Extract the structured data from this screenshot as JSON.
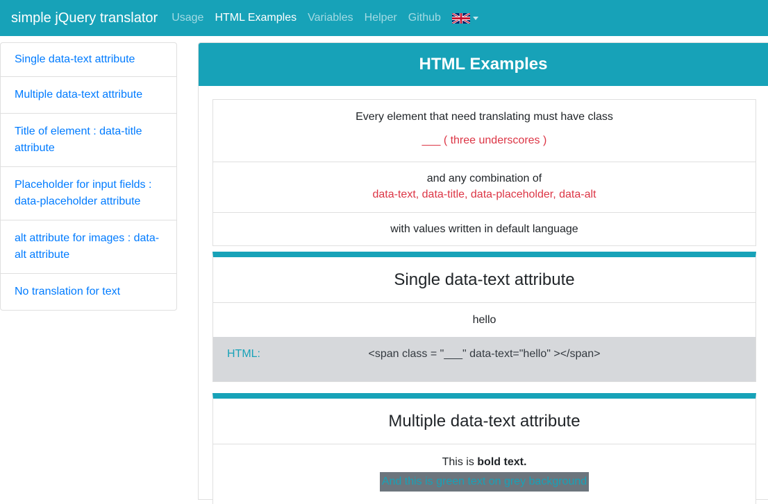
{
  "navbar": {
    "brand": "simple jQuery translator",
    "items": [
      {
        "label": "Usage",
        "active": false
      },
      {
        "label": "HTML Examples",
        "active": true
      },
      {
        "label": "Variables",
        "active": false
      },
      {
        "label": "Helper",
        "active": false
      },
      {
        "label": "Github",
        "active": false
      }
    ],
    "language_icon": "uk-flag-icon"
  },
  "sidebar": {
    "items": [
      {
        "label": "Single data-text attribute"
      },
      {
        "label": "Multiple data-text attribute"
      },
      {
        "label": "Title of element : data-title attribute"
      },
      {
        "label": "Placeholder for input fields : data-placeholder attribute"
      },
      {
        "label": "alt attribute for images : data-alt attribute"
      },
      {
        "label": "No translation for text"
      }
    ]
  },
  "main": {
    "title": "HTML Examples",
    "intro": {
      "line1": "Every element that need translating must have class",
      "line1_red": "___ ( three underscores )",
      "line2": "and any combination of",
      "line2_red": "data-text, data-title, data-placeholder, data-alt",
      "line3": "with values written in default language"
    },
    "single": {
      "title": "Single data-text attribute",
      "example": "hello",
      "html_label": "HTML:",
      "html_code": "<span class = \"___\" data-text=\"hello\" ></span>"
    },
    "multiple": {
      "title": "Multiple data-text attribute",
      "text_prefix": "This is ",
      "text_bold": "bold text.",
      "green_text": "And this is green text on grey background"
    }
  },
  "colors": {
    "accent": "#17a2b8",
    "link": "#007bff",
    "red": "#dc3545",
    "code_bg": "#d6d8db"
  }
}
